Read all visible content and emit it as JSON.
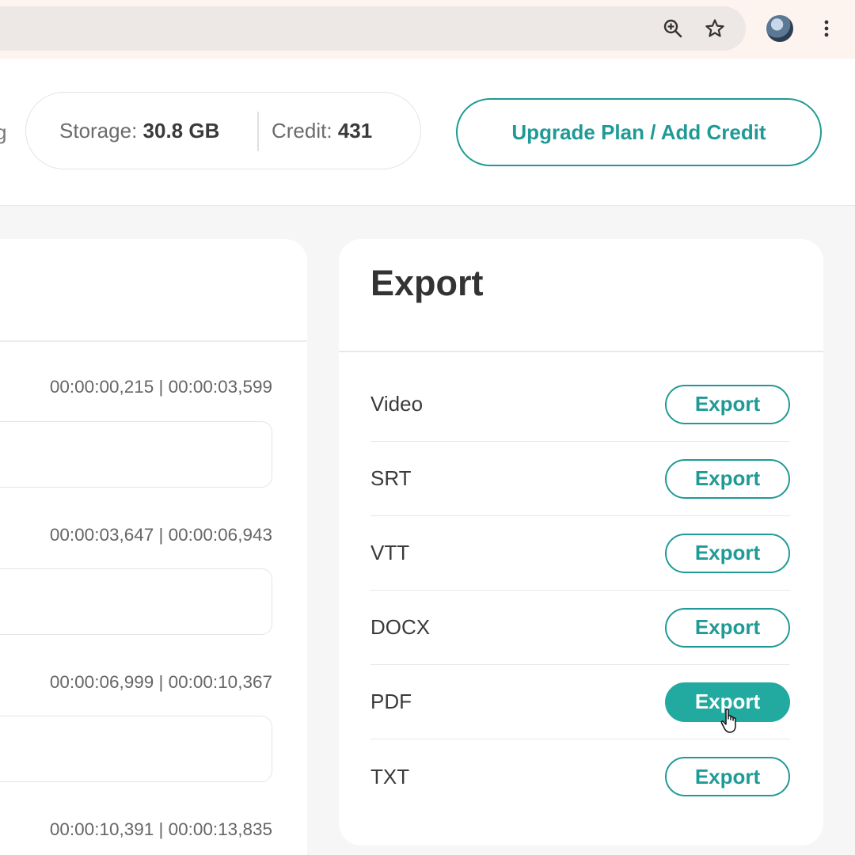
{
  "header": {
    "cut_label": "g",
    "storage_label": "Storage:",
    "storage_value": "30.8 GB",
    "credit_label": "Credit:",
    "credit_value": "431",
    "upgrade_label": "Upgrade Plan / Add Credit"
  },
  "transcript": {
    "segments": [
      {
        "timestamp": "00:00:00,215 | 00:00:03,599"
      },
      {
        "timestamp": "00:00:03,647 | 00:00:06,943"
      },
      {
        "timestamp": "00:00:06,999 | 00:00:10,367"
      },
      {
        "timestamp": "00:00:10,391 | 00:00:13,835"
      }
    ]
  },
  "export": {
    "title": "Export",
    "rows": [
      {
        "format": "Video",
        "button": "Export"
      },
      {
        "format": "SRT",
        "button": "Export"
      },
      {
        "format": "VTT",
        "button": "Export"
      },
      {
        "format": "DOCX",
        "button": "Export"
      },
      {
        "format": "PDF",
        "button": "Export"
      },
      {
        "format": "TXT",
        "button": "Export"
      }
    ]
  },
  "colors": {
    "accent": "#1f9a96",
    "accent_active": "#22aaa1"
  },
  "icons": [
    "zoom-in-icon",
    "star-icon",
    "avatar",
    "kebab-menu-icon",
    "hand-cursor-icon"
  ]
}
